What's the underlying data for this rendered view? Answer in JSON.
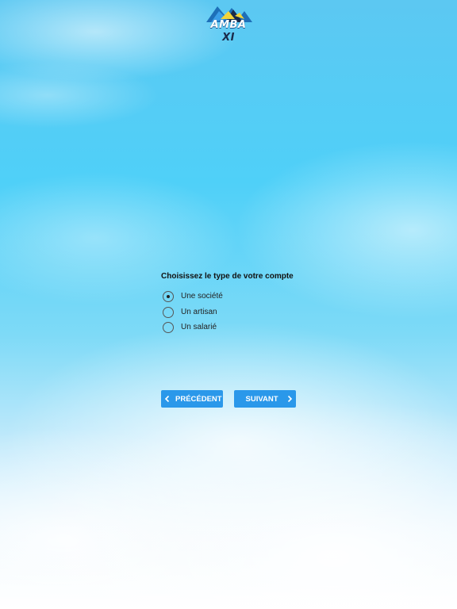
{
  "logo": {
    "text_main": "AMBA",
    "text_accent": "XI"
  },
  "form": {
    "title": "Choisissez le type de votre compte",
    "options": [
      {
        "label": "Une société",
        "checked": true
      },
      {
        "label": "Un artisan",
        "checked": false
      },
      {
        "label": "Un salarié",
        "checked": false
      }
    ]
  },
  "buttons": {
    "prev_label": "PRÉCÉDENT",
    "next_label": "SUIVANT"
  },
  "colors": {
    "button": "#2a98ea",
    "sky": "#4fd0f8"
  }
}
